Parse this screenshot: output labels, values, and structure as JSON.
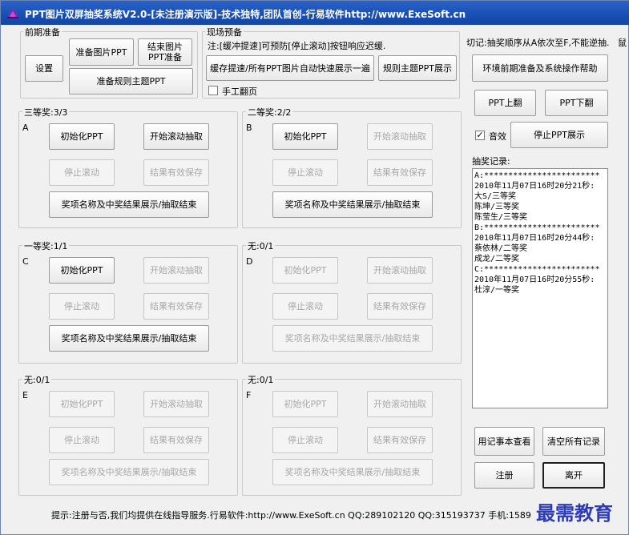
{
  "window": {
    "title": "PPT图片双屏抽奖系统V2.0-[未注册演示版]-技术独特,团队首创-行易软件http://www.ExeSoft.cn"
  },
  "prep": {
    "group_label": "前期准备",
    "settings": "设置",
    "prepare_image_ppt": "准备图片PPT",
    "end_image_ppt_line1": "结束图片",
    "end_image_ppt_line2": "PPT准备",
    "prepare_rules_ppt": "准备规则主题PPT"
  },
  "onsite": {
    "group_label": "现场预备",
    "note": "注:[缓冲提速]可预防[停止滚动]按钮响应迟缓.",
    "buffer_speedup": "缓存提速/所有PPT图片自动快速展示一遍",
    "rules_show": "规则主题PPT展示",
    "manual_page": "手工翻页",
    "manual_page_checked": false
  },
  "right_panel": {
    "note": "切记:抽奖顺序从A依次至F,不能逆抽.",
    "side_cut": "鼠",
    "help": "环境前期准备及系统操作帮助",
    "ppt_prev": "PPT上翻",
    "ppt_next": "PPT下翻",
    "sound": "音效",
    "sound_checked": true,
    "stop_ppt": "停止PPT展示",
    "log_label": "抽奖记录:",
    "log_lines": [
      "A:************************",
      "2010年11月07日16时20分21秒:",
      "大S/三等奖",
      "陈坤/三等奖",
      "陈莹生/三等奖",
      "B:************************",
      "2010年11月07日16时20分44秒:",
      "蔡依林/二等奖",
      "成龙/二等奖",
      "C:************************",
      "2010年11月07日16时20分55秒:",
      "杜淳/一等奖"
    ],
    "notepad_view": "用记事本查看",
    "clear_all": "清空所有记录",
    "register": "注册",
    "exit": "离开"
  },
  "prize_buttons": {
    "init": "初始化PPT",
    "start": "开始滚动抽取",
    "stop": "停止滚动",
    "save": "结果有效保存",
    "show_end": "奖项名称及中奖结果展示/抽取结束"
  },
  "groups": [
    {
      "label": "三等奖:3/3",
      "letter": "A"
    },
    {
      "label": "二等奖:2/2",
      "letter": "B"
    },
    {
      "label": "一等奖:1/1",
      "letter": "C"
    },
    {
      "label": "无:0/1",
      "letter": "D"
    },
    {
      "label": "无:0/1",
      "letter": "E"
    },
    {
      "label": "无:0/1",
      "letter": "F"
    }
  ],
  "status": "提示:注册与否,我们均提供在线指导服务.行易软件:http://www.ExeSoft.cn QQ:289102120 QQ:315193737 手机:1589",
  "watermark": "最需教育"
}
